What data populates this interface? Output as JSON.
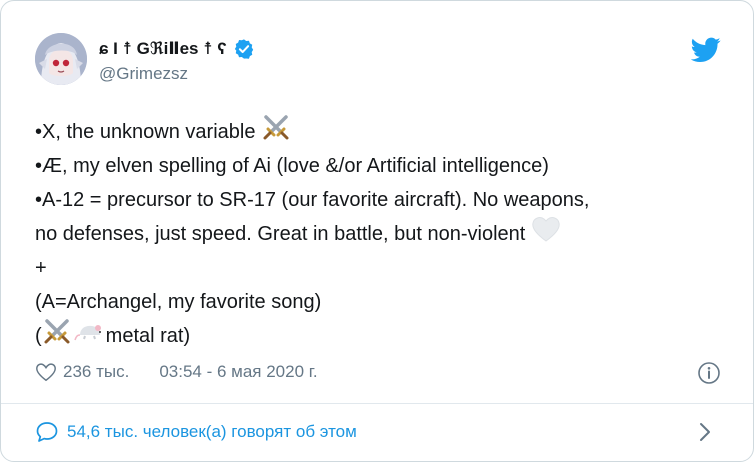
{
  "tweet": {
    "display_name": "ɕ Ɩ ☨ GℜiⅡes ☨ ʕ",
    "handle": "@Grimezsz",
    "lines": [
      "•X, the unknown variable",
      "•Æ, my elven spelling of Ai (love &/or Artificial intelligence)",
      "•A-12 = precursor to SR-17 (our favorite aircraft).  No weapons,",
      "no defenses, just speed.  Great in battle, but non-violent",
      "+",
      "(A=Archangel, my favorite song)",
      "(",
      " metal rat)"
    ],
    "likes": "236 тыс.",
    "timestamp": "03:54 - 6 мая 2020 г.",
    "discussion": "54,6 тыс. человек(а) говорят об этом"
  },
  "colors": {
    "accent": "#1da1f2",
    "muted": "#657786",
    "link": "#1b95e0"
  },
  "icons": [
    "verified-badge-icon",
    "twitter-bird-icon",
    "heart-icon",
    "info-icon",
    "comment-bubble-icon",
    "chevron-right-icon",
    "crossed-swords-icon",
    "white-heart-icon",
    "rat-icon"
  ]
}
